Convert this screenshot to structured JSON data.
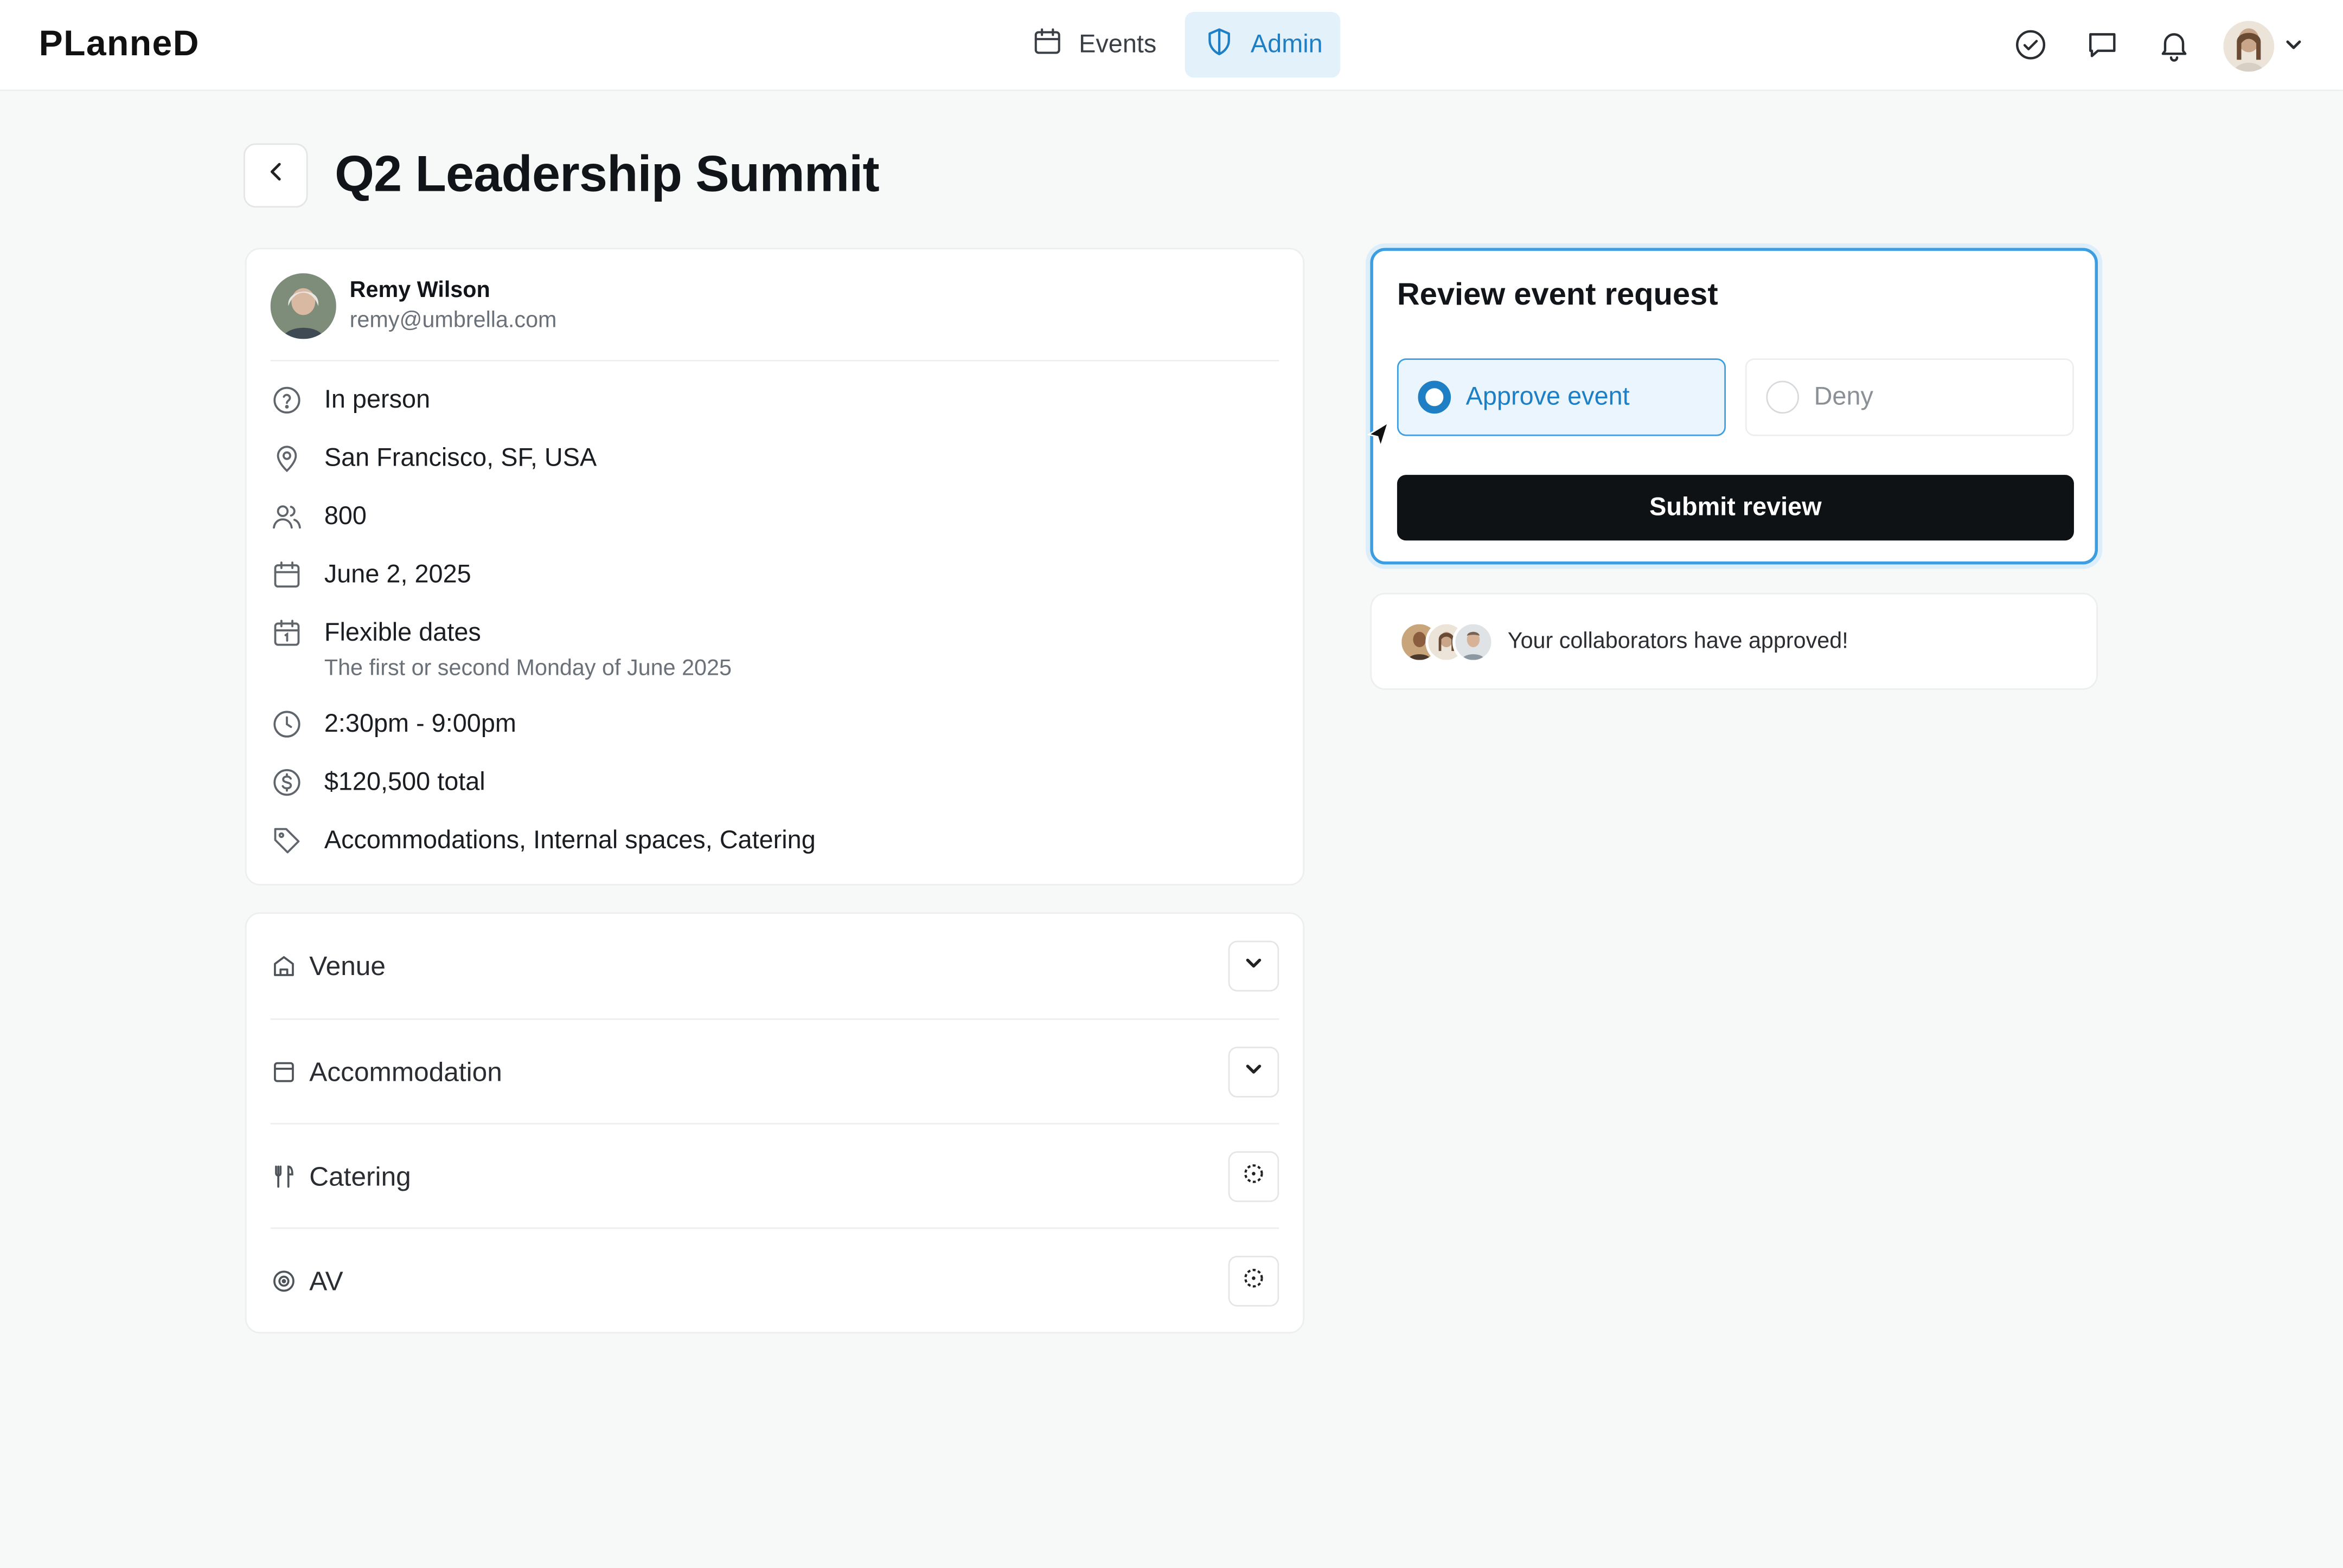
{
  "brand": {
    "logo": "PLanneD"
  },
  "nav": {
    "tabs": [
      {
        "label": "Events",
        "icon": "calendar-icon",
        "active": false
      },
      {
        "label": "Admin",
        "icon": "shield-icon",
        "active": true
      }
    ],
    "accent": "#1f7fc4"
  },
  "page": {
    "title": "Q2 Leadership Summit"
  },
  "requester": {
    "name": "Remy Wilson",
    "email": "remy@umbrella.com"
  },
  "details": {
    "format": "In person",
    "location": "San Francisco, SF, USA",
    "attendees": "800",
    "date": "June 2, 2025",
    "flexible_title": "Flexible dates",
    "flexible_note": "The first or second Monday of June 2025",
    "time": "2:30pm - 9:00pm",
    "budget": "$120,500 total",
    "tags": "Accommodations, Internal spaces, Catering"
  },
  "sections": [
    {
      "label": "Venue",
      "icon": "home-icon",
      "action": "chevron-down-icon"
    },
    {
      "label": "Accommodation",
      "icon": "bed-icon",
      "action": "chevron-down-icon"
    },
    {
      "label": "Catering",
      "icon": "utensils-icon",
      "action": "focus-icon"
    },
    {
      "label": "AV",
      "icon": "speaker-icon",
      "action": "focus-icon"
    }
  ],
  "review": {
    "title": "Review event request",
    "approve_label": "Approve event",
    "deny_label": "Deny",
    "selected": "approve",
    "submit_label": "Submit review"
  },
  "collaborators": {
    "message": "Your collaborators have approved!"
  }
}
